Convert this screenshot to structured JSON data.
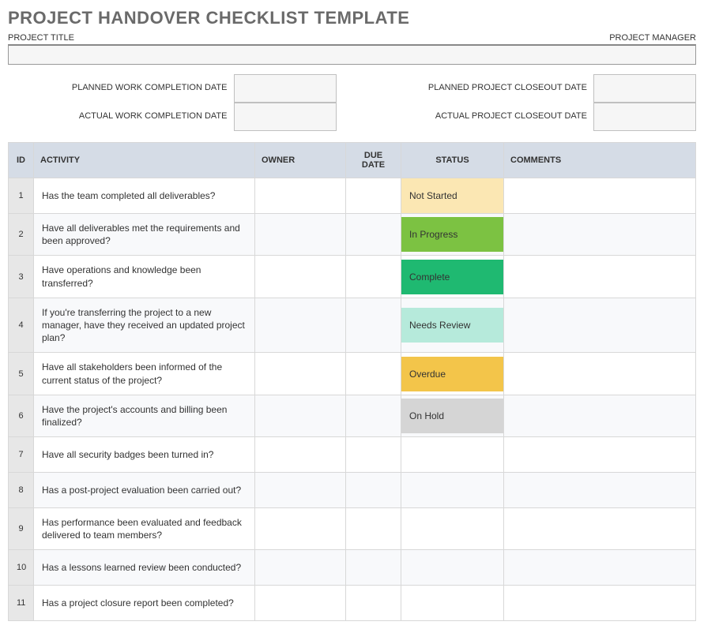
{
  "title": "PROJECT HANDOVER CHECKLIST TEMPLATE",
  "labels": {
    "projectTitle": "PROJECT TITLE",
    "projectManager": "PROJECT MANAGER",
    "plannedWork": "PLANNED WORK COMPLETION DATE",
    "actualWork": "ACTUAL WORK COMPLETION DATE",
    "plannedCloseout": "PLANNED PROJECT CLOSEOUT DATE",
    "actualCloseout": "ACTUAL PROJECT CLOSEOUT DATE"
  },
  "headers": {
    "id": "ID",
    "activity": "ACTIVITY",
    "owner": "OWNER",
    "due": "DUE DATE",
    "status": "STATUS",
    "comments": "COMMENTS"
  },
  "statusColors": {
    "Not Started": "#fbe7b3",
    "In Progress": "#7cc242",
    "Complete": "#1fb971",
    "Needs Review": "#b6eadb",
    "Overdue": "#f3c54a",
    "On Hold": "#d5d5d5",
    "": ""
  },
  "rows": [
    {
      "id": "1",
      "activity": "Has the team completed all deliverables?",
      "owner": "",
      "due": "",
      "status": "Not Started",
      "comments": ""
    },
    {
      "id": "2",
      "activity": "Have all deliverables met the requirements and been approved?",
      "owner": "",
      "due": "",
      "status": "In Progress",
      "comments": ""
    },
    {
      "id": "3",
      "activity": "Have operations and knowledge been transferred?",
      "owner": "",
      "due": "",
      "status": "Complete",
      "comments": ""
    },
    {
      "id": "4",
      "activity": "If you're transferring the project to a new manager, have they received an updated project plan?",
      "owner": "",
      "due": "",
      "status": "Needs Review",
      "comments": ""
    },
    {
      "id": "5",
      "activity": "Have all stakeholders been informed of the current status of the project?",
      "owner": "",
      "due": "",
      "status": "Overdue",
      "comments": ""
    },
    {
      "id": "6",
      "activity": "Have the project's accounts and billing been finalized?",
      "owner": "",
      "due": "",
      "status": "On Hold",
      "comments": ""
    },
    {
      "id": "7",
      "activity": "Have all security badges been turned in?",
      "owner": "",
      "due": "",
      "status": "",
      "comments": ""
    },
    {
      "id": "8",
      "activity": "Has a post-project evaluation been carried out?",
      "owner": "",
      "due": "",
      "status": "",
      "comments": ""
    },
    {
      "id": "9",
      "activity": "Has performance been evaluated and feedback delivered to team members?",
      "owner": "",
      "due": "",
      "status": "",
      "comments": ""
    },
    {
      "id": "10",
      "activity": "Has a lessons learned review been conducted?",
      "owner": "",
      "due": "",
      "status": "",
      "comments": ""
    },
    {
      "id": "11",
      "activity": "Has a project closure report been completed?",
      "owner": "",
      "due": "",
      "status": "",
      "comments": ""
    }
  ]
}
